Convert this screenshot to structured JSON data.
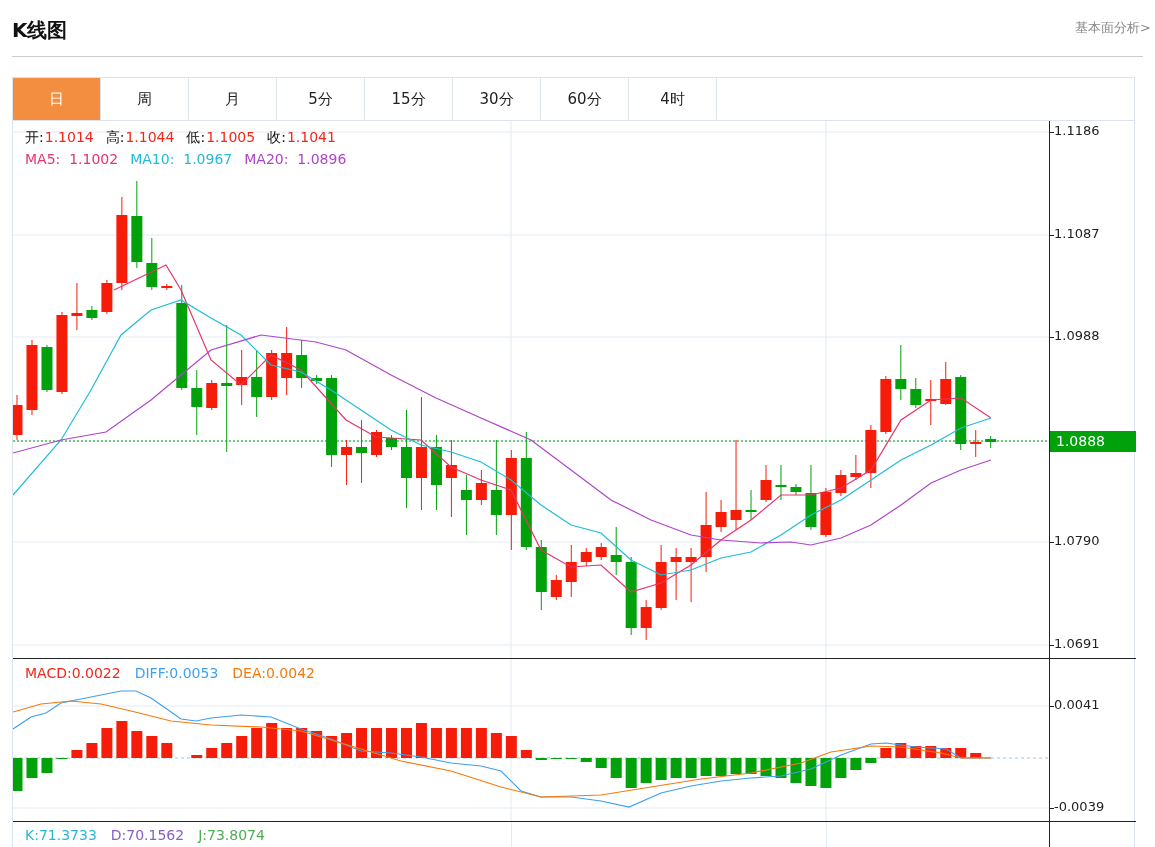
{
  "header": {
    "title": "K线图",
    "link": "基本面分析>"
  },
  "tabs": [
    {
      "label": "日",
      "selected": true
    },
    {
      "label": "周",
      "selected": false
    },
    {
      "label": "月",
      "selected": false
    },
    {
      "label": "5分",
      "selected": false
    },
    {
      "label": "15分",
      "selected": false
    },
    {
      "label": "30分",
      "selected": false
    },
    {
      "label": "60分",
      "selected": false
    },
    {
      "label": "4时",
      "selected": false
    }
  ],
  "price_panel": {
    "ohlc": [
      {
        "label": "开:",
        "value": "1.1014"
      },
      {
        "label": "高:",
        "value": "1.1044"
      },
      {
        "label": "低:",
        "value": "1.1005"
      },
      {
        "label": "收:",
        "value": "1.1041"
      }
    ],
    "ma": [
      {
        "text": "MA5:  1.1002",
        "color": "#e8336b"
      },
      {
        "text": "MA10:  1.0967",
        "color": "#1fbdd6"
      },
      {
        "text": "MA20:  1.0896",
        "color": "#b044c8"
      }
    ],
    "axis_labels": [
      "1.1186",
      "1.1087",
      "1.0988",
      "1.0790",
      "1.0691"
    ],
    "current_price": "1.0888"
  },
  "macd_panel": {
    "legend": [
      {
        "text": "MACD:0.0022",
        "color": "#f2261a"
      },
      {
        "text": "DIFF:0.0053",
        "color": "#3ea0ee"
      },
      {
        "text": "DEA:0.0042",
        "color": "#f57a0c"
      }
    ],
    "axis_labels": [
      "0.0041",
      "-0.0039"
    ]
  },
  "kdj_panel": {
    "legend": [
      {
        "text": "K:71.3733",
        "color": "#29b6d6"
      },
      {
        "text": "D:70.1562",
        "color": "#8a5fc8"
      },
      {
        "text": "J:73.8074",
        "color": "#4caf50"
      }
    ]
  }
}
